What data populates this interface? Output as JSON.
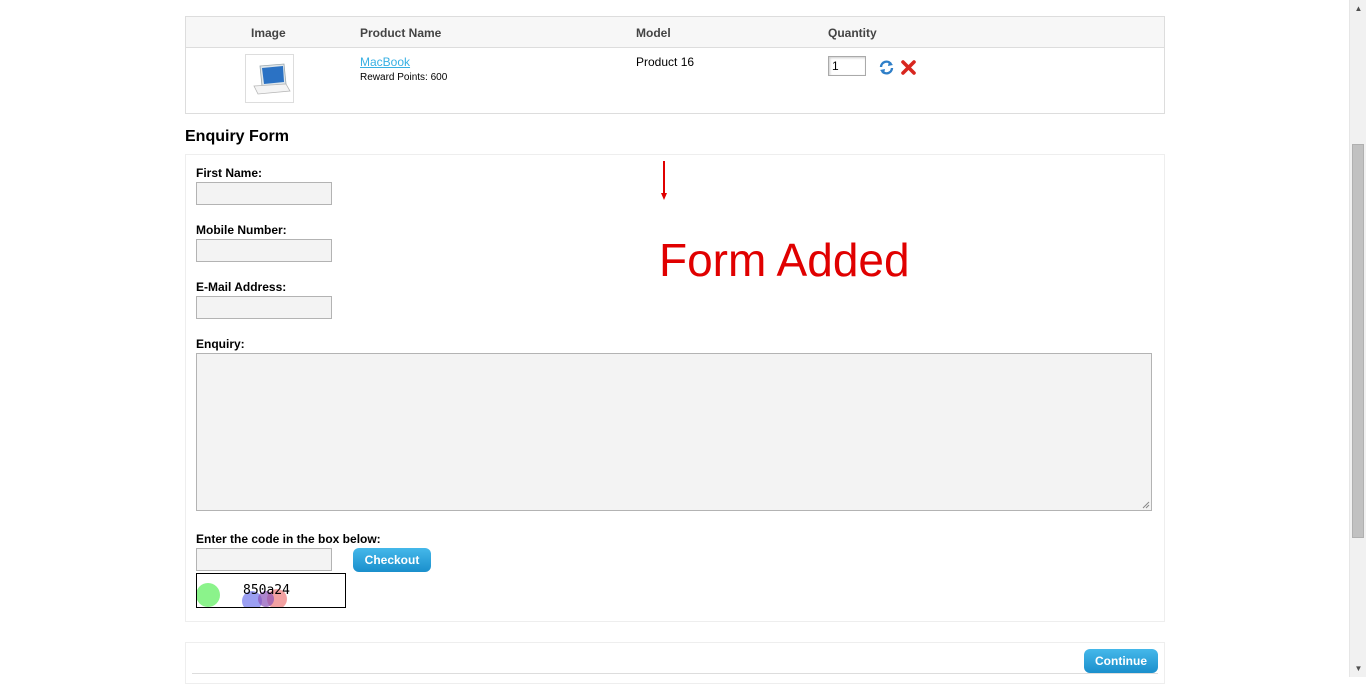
{
  "cart": {
    "headers": {
      "image": "Image",
      "product_name": "Product Name",
      "model": "Model",
      "quantity": "Quantity"
    },
    "row": {
      "product_name": "MacBook",
      "reward_points": "Reward Points: 600",
      "model": "Product 16",
      "quantity": "1",
      "update_icon": "refresh-icon",
      "remove_icon": "remove-icon"
    }
  },
  "form": {
    "title": "Enquiry Form",
    "first_name_label": "First Name:",
    "mobile_label": "Mobile Number:",
    "email_label": "E-Mail Address:",
    "enquiry_label": "Enquiry:",
    "captcha_label": "Enter the code in the box below:",
    "checkout_label": "Checkout",
    "captcha_code": "850a24"
  },
  "annotation": {
    "text": "Form Added",
    "color": "#e00000"
  },
  "footer": {
    "continue_label": "Continue"
  },
  "colors": {
    "accent": "#1fa0d9",
    "link": "#38b0e3"
  }
}
